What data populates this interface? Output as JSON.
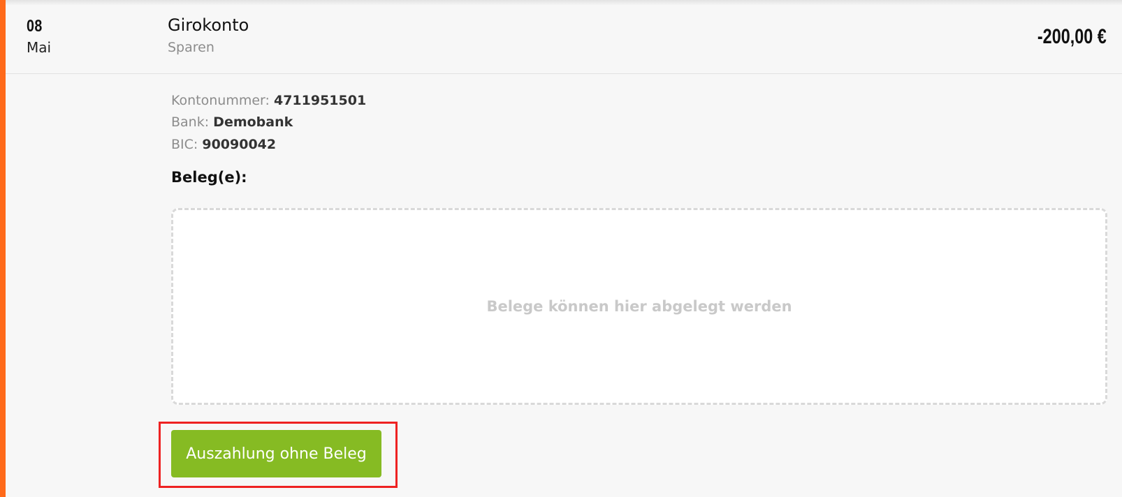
{
  "transaction": {
    "date_day": "08",
    "date_month": "Mai",
    "account_name": "Girokonto",
    "category": "Sparen",
    "amount": "-200,00 €"
  },
  "details": {
    "kontonummer_label": "Kontonummer:",
    "kontonummer_value": "4711951501",
    "bank_label": "Bank:",
    "bank_value": "Demobank",
    "bic_label": "BIC:",
    "bic_value": "90090042"
  },
  "belege": {
    "heading": "Beleg(e):",
    "dropzone_text": "Belege können hier abgelegt werden"
  },
  "actions": {
    "no_receipt_button": "Auszahlung ohne Beleg"
  },
  "colors": {
    "accent": "#ff6a1a",
    "button": "#86bb23",
    "highlight": "#ee2222"
  }
}
